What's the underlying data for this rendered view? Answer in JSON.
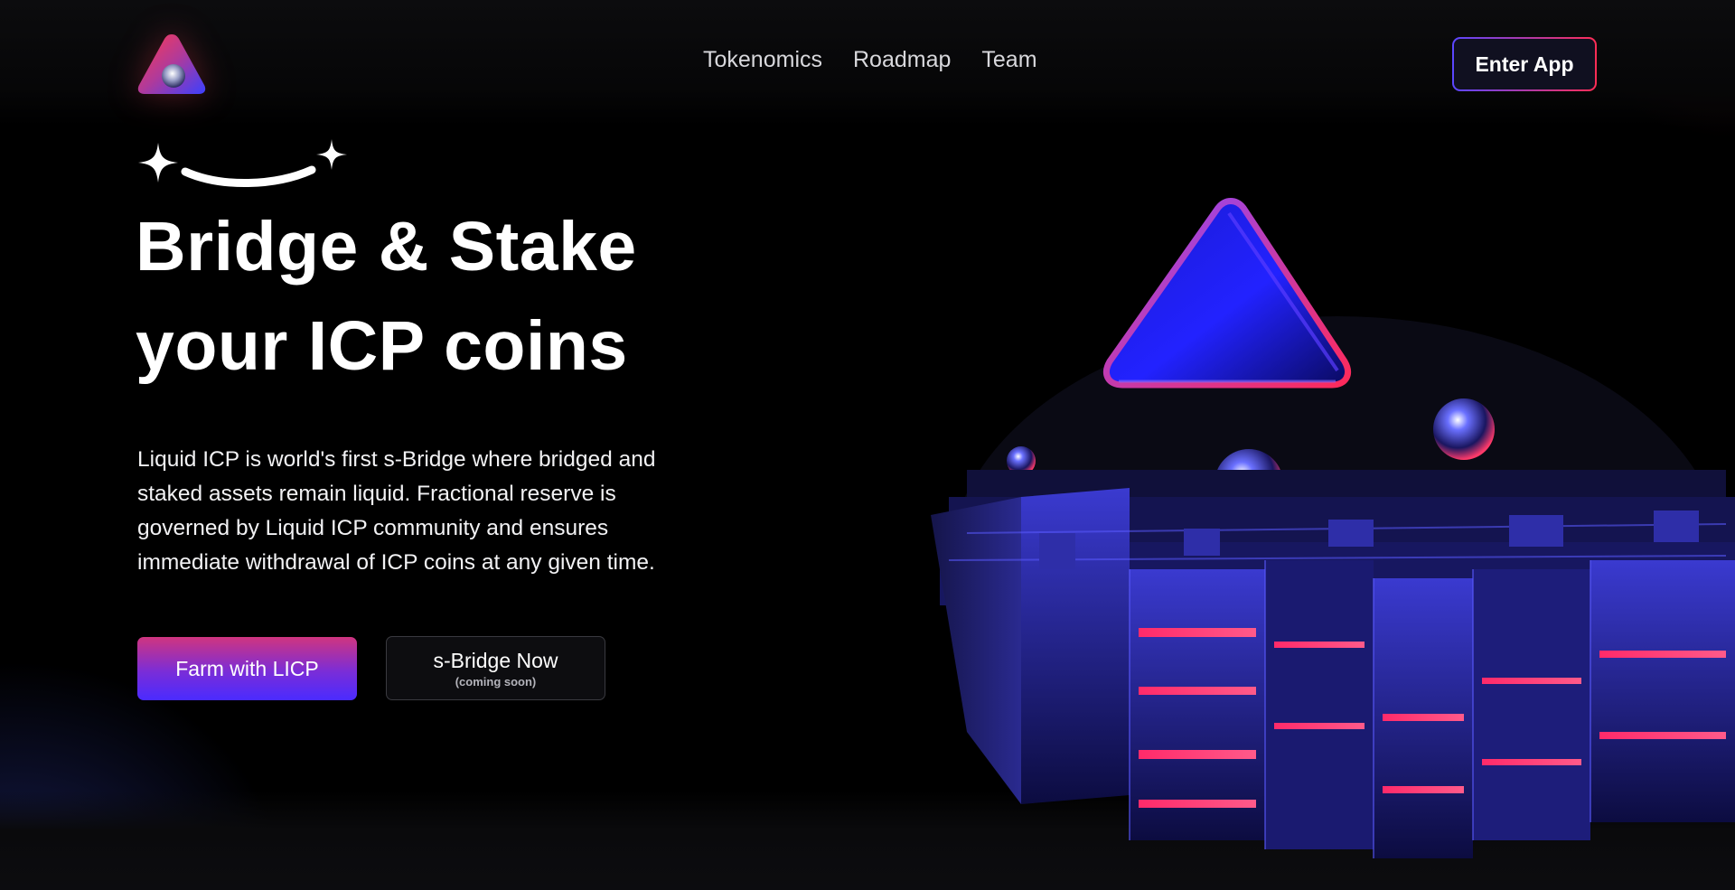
{
  "nav": {
    "links": [
      "Tokenomics",
      "Roadmap",
      "Team"
    ],
    "enter_app": "Enter App"
  },
  "hero": {
    "title_line1": "Bridge & Stake",
    "title_line2": "your ICP coins",
    "description": "Liquid ICP is world's first s-Bridge where bridged and staked assets remain liquid. Fractional reserve is governed by Liquid ICP community and ensures immediate withdrawal of ICP coins at any given time.",
    "buttons": {
      "farm": "Farm with LICP",
      "bridge": "s-Bridge Now",
      "bridge_note": "(coming soon)"
    }
  },
  "colors": {
    "accent_pink": "#ff2d55",
    "accent_blue": "#4a2bff",
    "background": "#000000"
  },
  "icons": {
    "logo": "triangle-logo-icon",
    "sparkle": "sparkle-smile-icon"
  }
}
